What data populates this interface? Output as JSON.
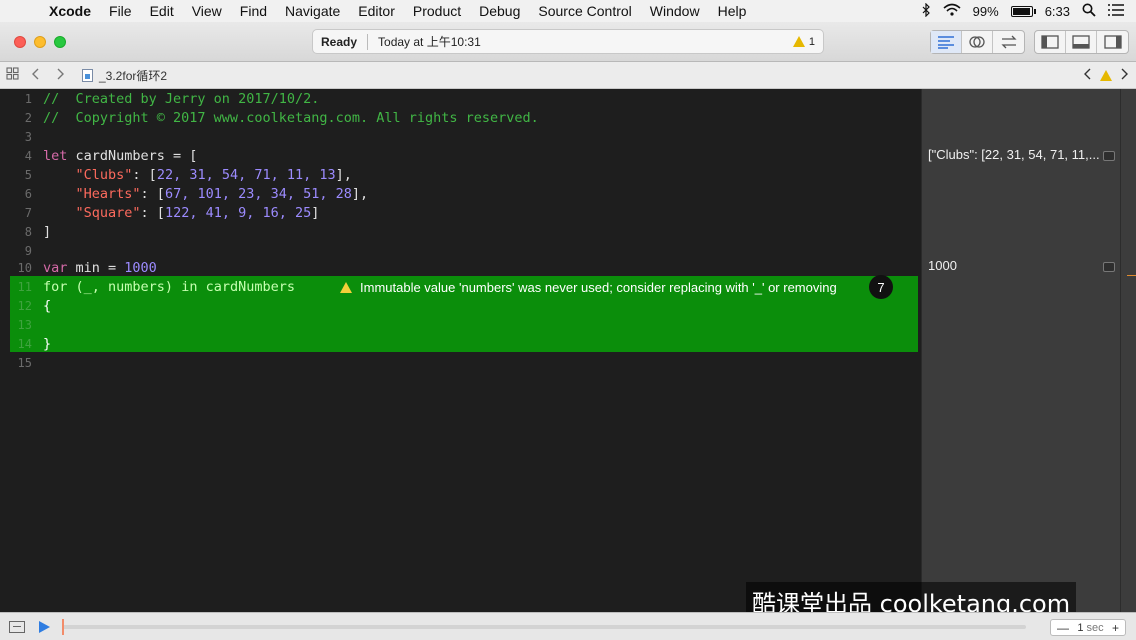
{
  "menubar": {
    "apple": "",
    "items": [
      "Xcode",
      "File",
      "Edit",
      "View",
      "Find",
      "Navigate",
      "Editor",
      "Product",
      "Debug",
      "Source Control",
      "Window",
      "Help"
    ],
    "battery_percent": "99%",
    "battery_level": 0.99,
    "time": "6:33"
  },
  "toolbar": {
    "status_ready": "Ready",
    "status_time": "Today at 上午10:31",
    "warning_count": "1"
  },
  "jumpbar": {
    "file_name": "_3.2for循环2"
  },
  "editor": {
    "line_numbers": [
      "1",
      "2",
      "3",
      "4",
      "5",
      "6",
      "7",
      "8",
      "9",
      "10",
      "11",
      "12",
      "13",
      "14",
      "15"
    ],
    "line1": "//  Created by Jerry on 2017/10/2.",
    "line2": "//  Copyright © 2017 www.coolketang.com. All rights reserved.",
    "line4": {
      "kw": "let",
      "rest": " cardNumbers = ["
    },
    "line5": {
      "str": "\"Clubs\"",
      "rest": ": [",
      "nums": "22, 31, 54, 71, 11, 13",
      "end": "],"
    },
    "line6": {
      "str": "\"Hearts\"",
      "rest": ": [",
      "nums": "67, 101, 23, 34, 51, 28",
      "end": "],"
    },
    "line7": {
      "str": "\"Square\"",
      "rest": ": [",
      "nums": "122, 41, 9, 16, 25",
      "end": "]"
    },
    "line8": "]",
    "line10": {
      "kw": "var",
      "rest": " min = ",
      "num": "1000"
    },
    "line11": {
      "kw": "for",
      "rest": " (_, numbers) ",
      "kw2": "in",
      "id": " cardNumbers"
    },
    "line12": "{",
    "line14": "}",
    "issue_message": "Immutable value 'numbers' was never used; consider replacing with '_' or removing",
    "issue_badge": "7"
  },
  "results": {
    "r1": "[\"Clubs\": [22, 31, 54, 71, 11,...",
    "r2": "1000"
  },
  "watermark": "酷课堂出品 coolketang.com",
  "debugbar": {
    "step_minus": "—",
    "step_value": "1",
    "step_unit": "sec",
    "step_plus": "+"
  }
}
